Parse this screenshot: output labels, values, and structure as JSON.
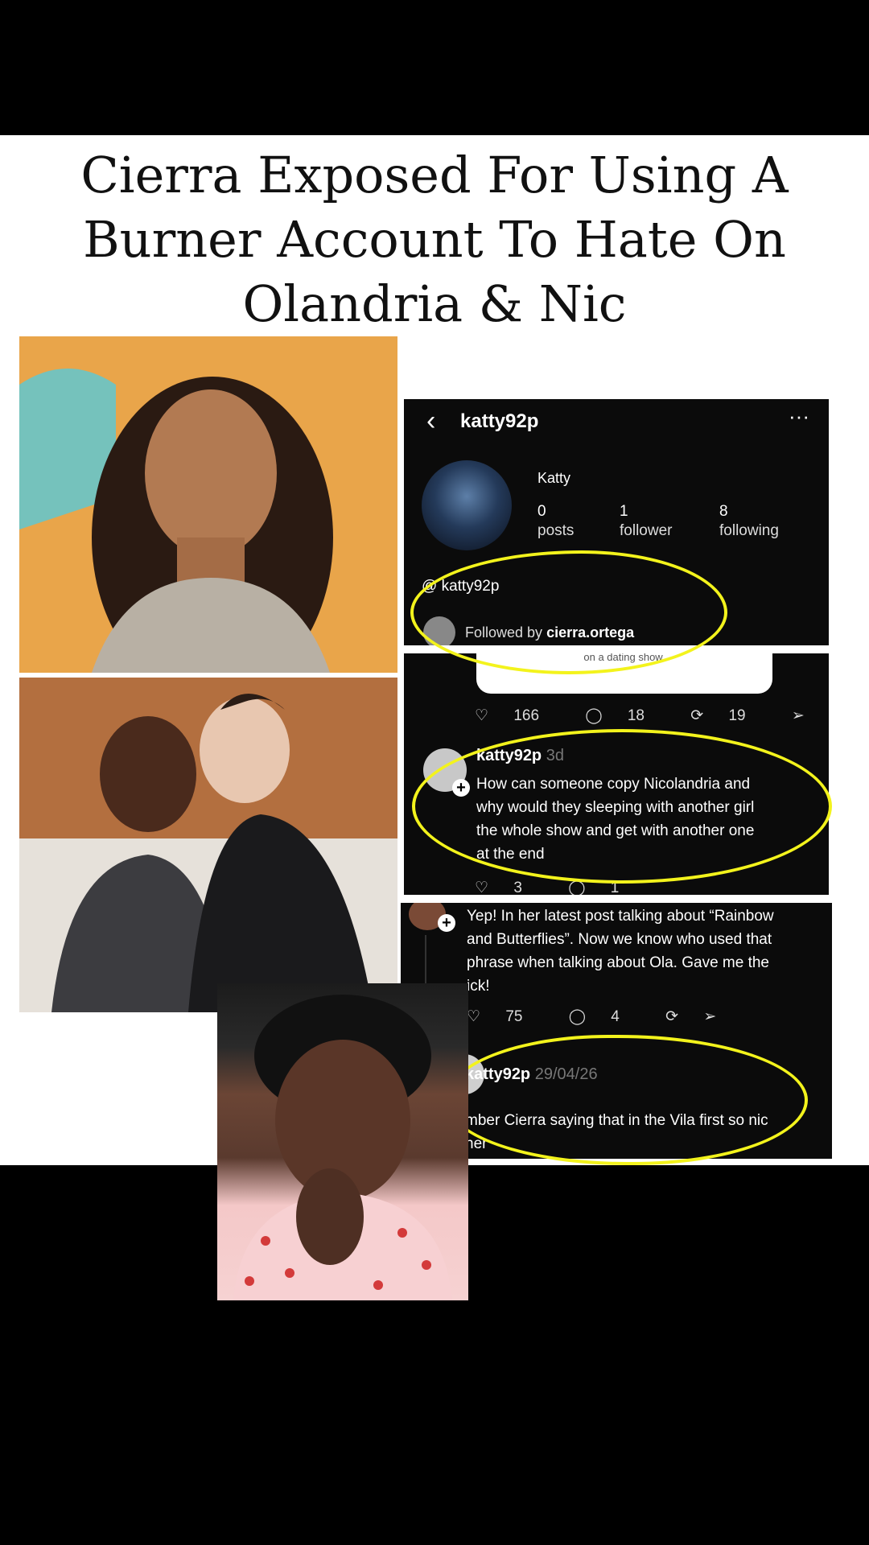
{
  "headline": {
    "line1": "Cierra Exposed For Using A",
    "line2": "Burner Account To Hate On",
    "line3": "Olandria & Nic"
  },
  "profile": {
    "back_glyph": "‹",
    "username": "katty92p",
    "more_glyph": "···",
    "display_name": "Katty",
    "posts_count": "0",
    "posts_label": "posts",
    "followers_count": "1",
    "followers_label": "follower",
    "following_count": "8",
    "following_label": "following",
    "threads_handle": "katty92p",
    "followed_by_prefix": "Followed by ",
    "followed_by_user": "cierra.ortega"
  },
  "comment1": {
    "card_text": "on a dating show.",
    "likes": "166",
    "replies": "18",
    "reposts": "19",
    "author": "katty92p",
    "ago": "3d",
    "text_line1": "How can someone copy Nicolandria and",
    "text_line2": "why would they sleeping with another girl",
    "text_line3": "the whole show and get with another one",
    "text_line4": "at the end",
    "footer_likes": "3",
    "footer_replies": "1"
  },
  "comment2": {
    "text_line1": "Yep! In her latest post talking about “Rainbow",
    "text_line2": "and Butterflies”. Now we know who used that",
    "text_line3": "phrase when talking about Ola. Gave me the",
    "text_line4": "ick!",
    "likes": "75",
    "replies": "4"
  },
  "comment3": {
    "author": "katty92p",
    "date": "29/04/26",
    "text_line1": "mber Cierra saying that in the Vila first  so nic",
    "text_line2": "her"
  },
  "icons": {
    "heart": "heart-icon",
    "reply": "comment-icon",
    "repost": "repost-icon",
    "share": "share-icon",
    "threads": "threads-icon"
  },
  "colors": {
    "highlight": "#f3f31c",
    "panel_bg": "#ffffff",
    "screenshot_bg": "#0b0b0b"
  }
}
